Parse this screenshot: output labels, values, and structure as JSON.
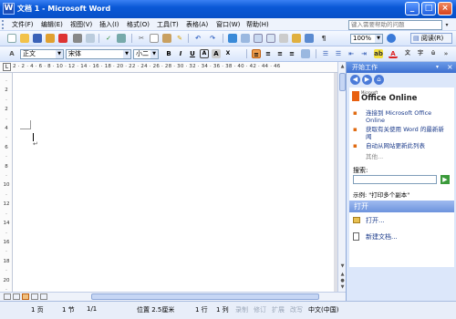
{
  "window": {
    "title": "文档 1 - Microsoft Word"
  },
  "menubar": {
    "items": [
      "文件(F)",
      "编辑(E)",
      "视图(V)",
      "插入(I)",
      "格式(O)",
      "工具(T)",
      "表格(A)",
      "窗口(W)",
      "帮助(H)"
    ],
    "help_placeholder": "键入需要帮助的问题"
  },
  "toolbar": {
    "zoom": "100%",
    "read_label": "阅读(R)",
    "style": "正文",
    "font": "宋体",
    "size": "小二"
  },
  "ruler": {
    "scale": "2 · 2 · 4 · 6 · 8 · 10 · 12 · 14 · 16 · 18 · 20 · 22 · 24 · 26 · 28 · 30 · 32 · 34 · 36 · 38 · 40 · 42 · 44 · 46"
  },
  "taskpane": {
    "title": "开始工作",
    "logo_small": "Microsoft",
    "logo": "Office Online",
    "links": [
      "连接到 Microsoft Office Online",
      "获取有关使用 Word 的最新新闻",
      "自动从网站更新此列表"
    ],
    "more": "其他...",
    "search_label": "搜索:",
    "example": "示例: \"打印多个副本\"",
    "open_section": "打开",
    "open_item": "打开...",
    "new_item": "新建文档..."
  },
  "statusbar": {
    "page": "1 页",
    "section": "1 节",
    "pages": "1/1",
    "position": "位置 2.5厘米",
    "line": "1 行",
    "col": "1 列",
    "rec": "录制",
    "trk": "修订",
    "ext": "扩展",
    "ovr": "改写",
    "lang": "中文(中国)"
  },
  "colors": {
    "accent": "#0a58d6",
    "taskpane": "#dce7fa"
  }
}
